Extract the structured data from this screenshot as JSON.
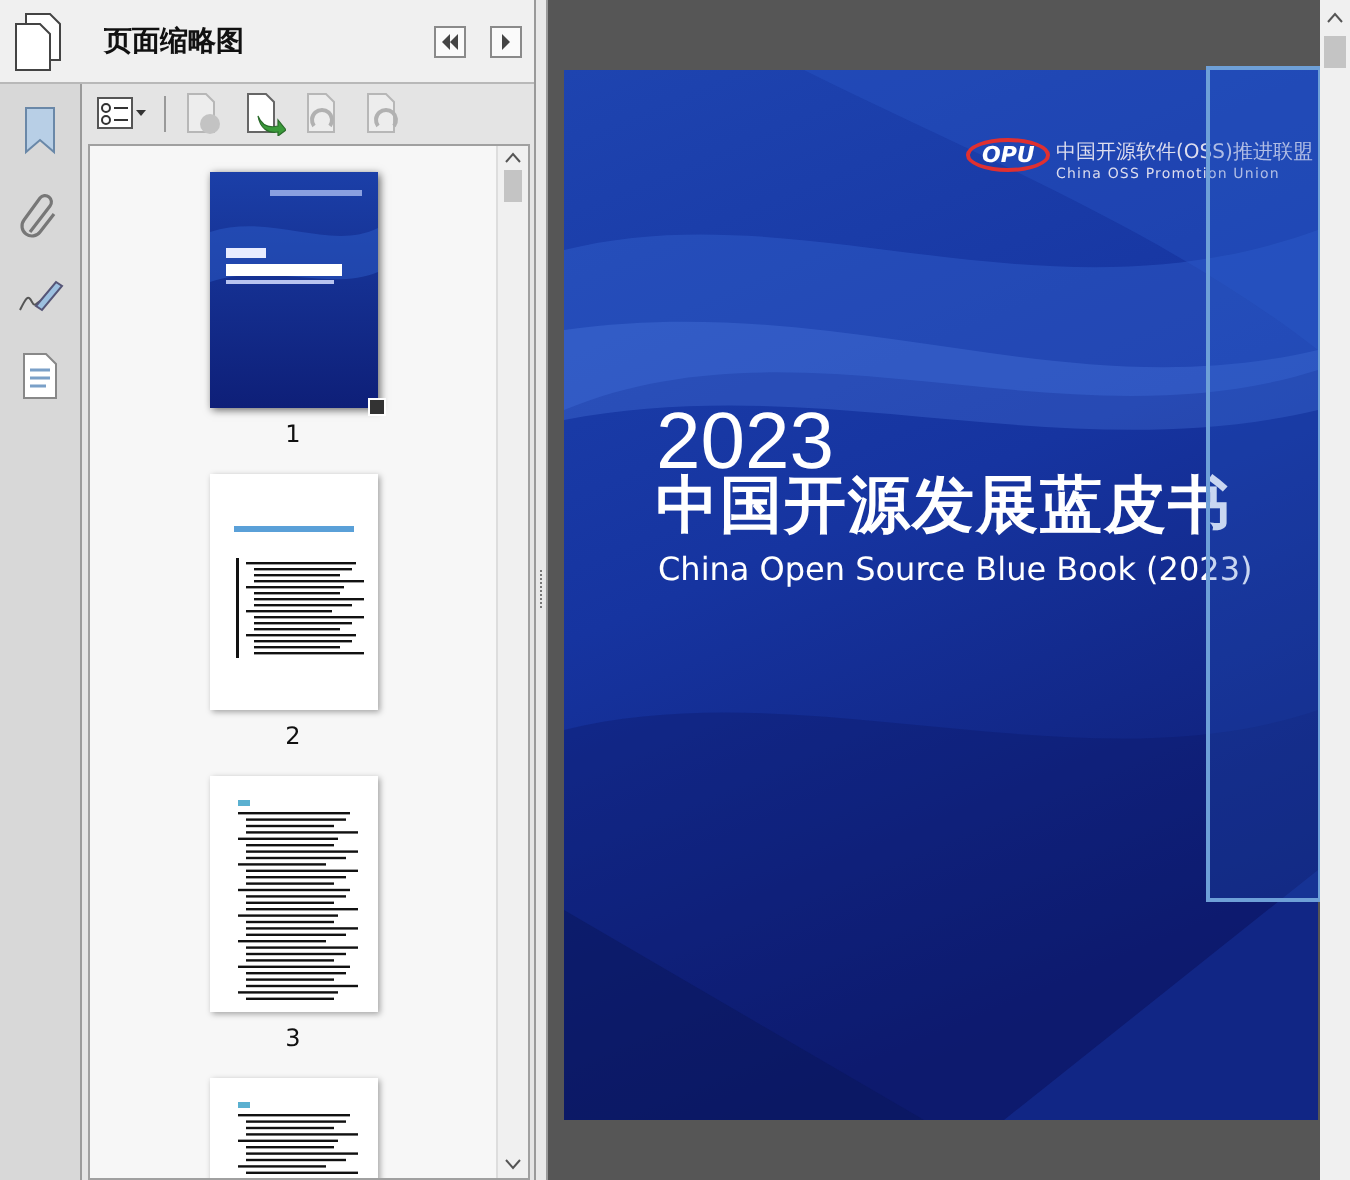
{
  "panel": {
    "title": "页面缩略图"
  },
  "sidebar": [
    {
      "kind": "bookmark"
    },
    {
      "kind": "attachment"
    },
    {
      "kind": "signature"
    },
    {
      "kind": "layers"
    }
  ],
  "toolbar": [
    {
      "kind": "options",
      "disabled": false
    },
    {
      "kind": "delete",
      "disabled": true
    },
    {
      "kind": "insert",
      "disabled": false
    },
    {
      "kind": "rotate-left",
      "disabled": true
    },
    {
      "kind": "rotate-right",
      "disabled": true
    }
  ],
  "thumbnails": [
    {
      "label": "1",
      "kind": "cover",
      "selected": true
    },
    {
      "label": "2",
      "kind": "title-page",
      "selected": false
    },
    {
      "label": "3",
      "kind": "contents",
      "selected": false
    },
    {
      "kind": "contents",
      "selected": false
    }
  ],
  "page": {
    "logo_mark": "OPU",
    "logo_name": "中国开源软件(OSS)推进联盟",
    "logo_name_en": "China OSS Promotion Union",
    "year": "2023",
    "title": "中国开源发展蓝皮书",
    "subtitle": "China Open Source Blue Book (2023)"
  }
}
